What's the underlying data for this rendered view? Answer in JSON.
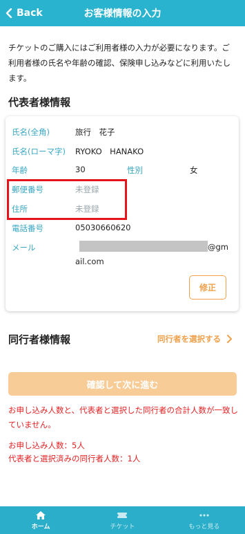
{
  "header": {
    "back_label": "Back",
    "title": "お客様情報の入力"
  },
  "intro_text": "チケットのご購入にはご利用者様の入力が必要になります。ご利用者様の氏名や年齢の確認、保険申し込みなどに利用いたします。",
  "representative": {
    "section_title": "代表者様情報",
    "name_label": "氏名(全角)",
    "name_value": "旅行　花子",
    "roman_label": "氏名(ローマ字)",
    "roman_value": "RYOKO　HANAKO",
    "age_label": "年齢",
    "age_value": "30",
    "gender_label": "性別",
    "gender_value": "女",
    "postal_label": "郵便番号",
    "postal_value": "未登録",
    "address_label": "住所",
    "address_value": "未登録",
    "phone_label": "電話番号",
    "phone_value": "05030660620",
    "email_label": "メール",
    "email_value_suffix": "@gm",
    "email_value_line2": "ail.com",
    "edit_label": "修正"
  },
  "companion": {
    "section_title": "同行者様情報",
    "select_label": "同行者を選択する"
  },
  "confirm_label": "確認して次に進む",
  "error": {
    "message": "お申し込み人数と、代表者と選択した同行者の合計人数が一致していません。",
    "applicants": "お申し込み人数：5人",
    "selected": "代表者と選択済みの同行者人数：1人"
  },
  "nav": {
    "home": "ホーム",
    "ticket": "チケット",
    "more": "もっと見る"
  },
  "colors": {
    "header": "#29b3cf",
    "accent": "#f0a04b",
    "error": "#e32224",
    "label": "#3aa7c3"
  }
}
